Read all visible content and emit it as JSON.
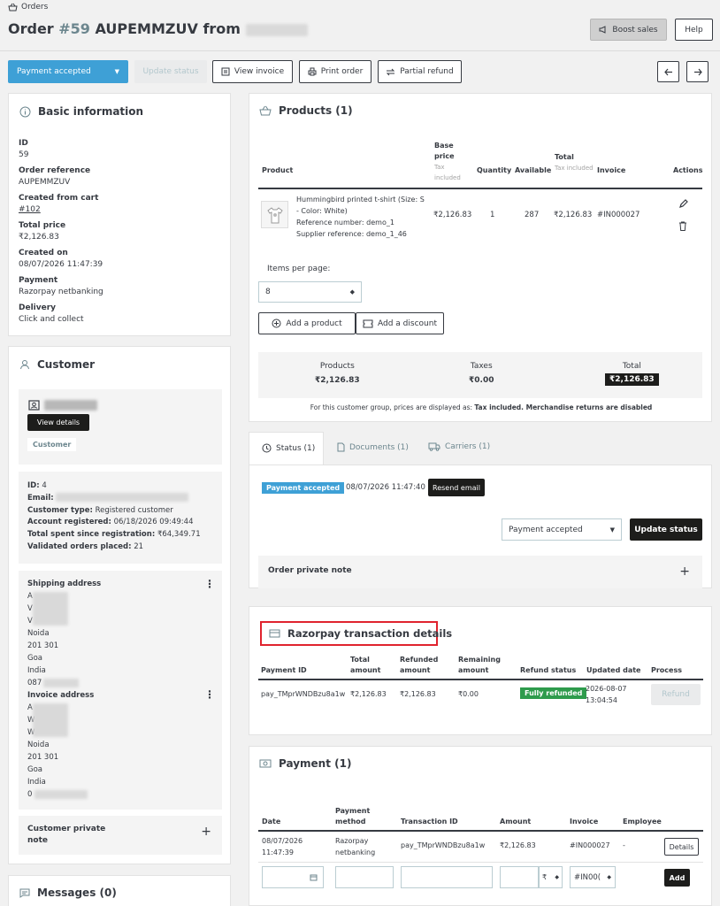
{
  "breadcrumb": {
    "label": "Orders"
  },
  "header": {
    "title_prefix": "Order ",
    "order_number": "#59",
    "title_suffix": " AUPEMMZUV from ",
    "boost_label": "Boost sales",
    "help_label": "Help"
  },
  "toolbar": {
    "status_select": "Payment accepted",
    "update_status": "Update status",
    "view_invoice": "View invoice",
    "print_order": "Print order",
    "partial_refund": "Partial refund"
  },
  "basic_info": {
    "title": "Basic information",
    "fields": [
      {
        "label": "ID",
        "value": "59"
      },
      {
        "label": "Order reference",
        "value": "AUPEMMZUV"
      },
      {
        "label": "Created from cart",
        "value": "#102"
      },
      {
        "label": "Total price",
        "value": "₹2,126.83"
      },
      {
        "label": "Created on",
        "value": "08/07/2026 11:47:39"
      },
      {
        "label": "Payment",
        "value": "Razorpay netbanking"
      },
      {
        "label": "Delivery",
        "value": "Click and collect"
      }
    ]
  },
  "customer": {
    "title": "Customer",
    "view_details": "View details",
    "customer_tag": "Customer",
    "id_label": "ID:",
    "id_value": "4",
    "email_label": "Email:",
    "type_label": "Customer type:",
    "type_value": "Registered customer",
    "registered_label": "Account registered:",
    "registered_value": "06/18/2026 09:49:44",
    "spent_label": "Total spent since registration:",
    "spent_value": "₹64,349.71",
    "validated_label": "Validated orders placed:",
    "validated_value": "21",
    "shipping_title": "Shipping address",
    "shipping_lines": [
      "A",
      "V",
      "V",
      "Noida",
      "201 301",
      "Goa",
      "India",
      "087"
    ],
    "invoice_title": "Invoice address",
    "invoice_lines": [
      "A",
      "W",
      "W",
      "Noida",
      "201 301",
      "Goa",
      "India",
      "0"
    ],
    "private_note": "Customer private note"
  },
  "messages": {
    "title": "Messages (0)"
  },
  "products": {
    "title": "Products (1)",
    "headers": {
      "product": "Product",
      "base_price": "Base price",
      "tax_included": "Tax included",
      "quantity": "Quantity",
      "available": "Available",
      "total": "Total",
      "invoice": "Invoice",
      "actions": "Actions"
    },
    "row": {
      "name": "Hummingbird printed t-shirt (Size: S - Color: White)",
      "reference": "Reference number: demo_1",
      "supplier": "Supplier reference: demo_1_46",
      "base_price": "₹2,126.83",
      "quantity": "1",
      "available": "287",
      "total": "₹2,126.83",
      "invoice": "#IN000027"
    },
    "items_per_page_label": "Items per page:",
    "items_per_page": "8",
    "add_product": "Add a product",
    "add_discount": "Add a discount",
    "summary": {
      "products_label": "Products",
      "products_value": "₹2,126.83",
      "taxes_label": "Taxes",
      "taxes_value": "₹0.00",
      "total_label": "Total",
      "total_value": "₹2,126.83"
    },
    "note_prefix": "For this customer group, prices are displayed as: ",
    "note_bold": "Tax included. Merchandise returns are disabled"
  },
  "tabs": {
    "status": "Status (1)",
    "documents": "Documents (1)",
    "carriers": "Carriers (1)"
  },
  "status": {
    "badge": "Payment accepted",
    "date": "08/07/2026 11:47:40",
    "resend": "Resend email",
    "select": "Payment accepted",
    "update": "Update status",
    "private_note": "Order private note"
  },
  "razorpay": {
    "title": "Razorpay transaction details",
    "headers": [
      "Payment ID",
      "Total amount",
      "Refunded amount",
      "Remaining amount",
      "Refund status",
      "Updated date",
      "Process"
    ],
    "row": {
      "payment_id": "pay_TMprWNDBzu8a1w",
      "total": "₹2,126.83",
      "refunded": "₹2,126.83",
      "remaining": "₹0.00",
      "status": "Fully refunded",
      "updated_date": "2026-08-07",
      "updated_time": "13:04:54",
      "refund_button": "Refund"
    }
  },
  "payment": {
    "title": "Payment (1)",
    "headers": [
      "Date",
      "Payment method",
      "Transaction ID",
      "Amount",
      "Invoice",
      "Employee"
    ],
    "row": {
      "date": "08/07/2026",
      "time": "11:47:39",
      "method": "Razorpay netbanking",
      "transaction": "pay_TMprWNDBzu8a1w",
      "amount": "₹2,126.83",
      "invoice": "#IN000027",
      "employee": "-",
      "details": "Details"
    },
    "new_currency": "₹",
    "new_invoice": "#IN00(",
    "add": "Add"
  }
}
